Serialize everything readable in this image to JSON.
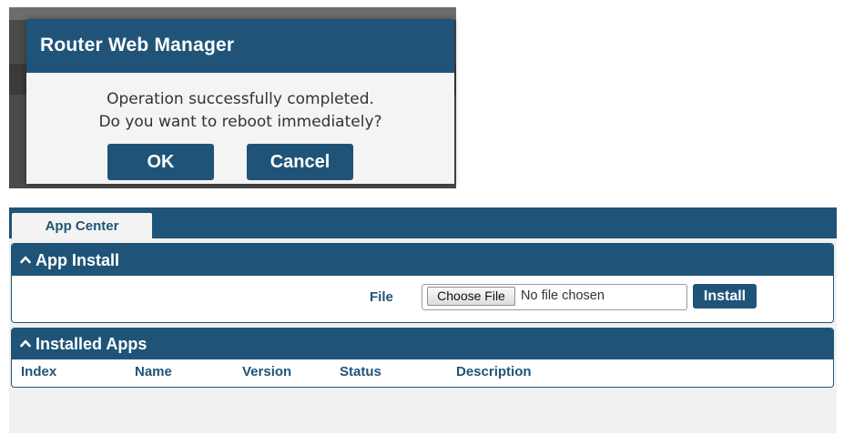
{
  "dialog": {
    "title": "Router Web Manager",
    "message_line1": "Operation successfully completed.",
    "message_line2": "Do you want to reboot immediately?",
    "ok_label": "OK",
    "cancel_label": "Cancel"
  },
  "app_center": {
    "tab_label": "App Center",
    "install_section": {
      "title": "App Install",
      "file_label": "File",
      "choose_file_label": "Choose File",
      "no_file_text": "No file chosen",
      "install_label": "Install"
    },
    "installed_section": {
      "title": "Installed Apps",
      "columns": [
        "Index",
        "Name",
        "Version",
        "Status",
        "Description"
      ]
    }
  },
  "colors": {
    "accent": "#1f5478",
    "panel_bg": "#f1f1f1",
    "dialog_bg": "#f4f4f4"
  }
}
